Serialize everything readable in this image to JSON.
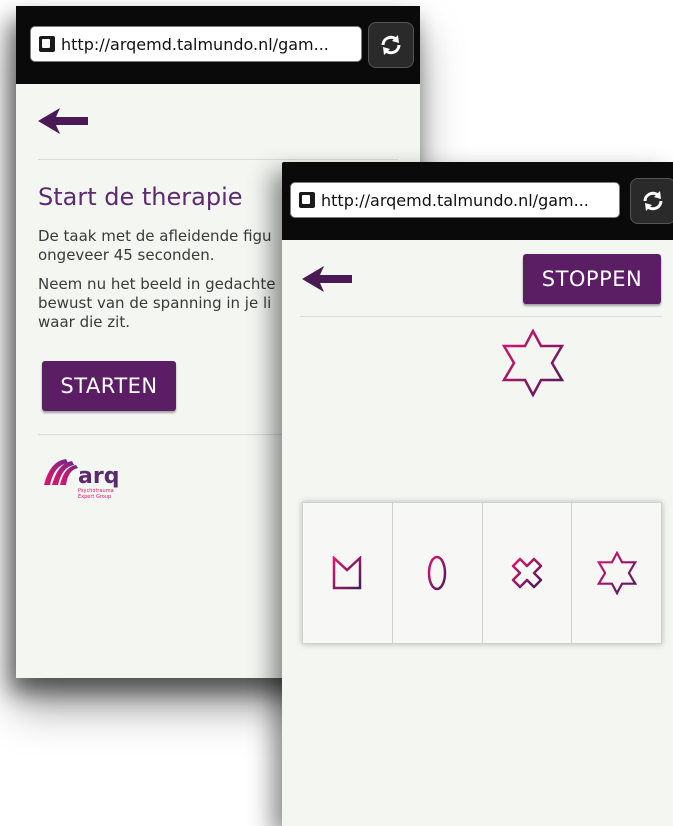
{
  "back_screen": {
    "url": "http://arqemd.talmundo.nl/gam...",
    "title": "Start de therapie",
    "paragraph1": "De taak met de afleidende figu\nongeveer 45 seconden.",
    "paragraph2": "Neem nu het beeld in gedachte\nbewust van de spanning in je li\nwaar die zit.",
    "start_button": "STARTEN",
    "logo_text": "arq",
    "logo_subtext": "Psychotrauma\nExpert Group"
  },
  "front_screen": {
    "url": "http://arqemd.talmundo.nl/gam...",
    "stop_button": "STOPPEN",
    "target_shape": "star-of-david-icon",
    "choices": [
      "crown-icon",
      "oval-icon",
      "cross-icon",
      "star-of-david-icon"
    ]
  },
  "colors": {
    "accent": "#5b1e64",
    "heading": "#5c2a6e",
    "shape_gradient_start": "#e0156e",
    "shape_gradient_end": "#4a1a5c"
  }
}
